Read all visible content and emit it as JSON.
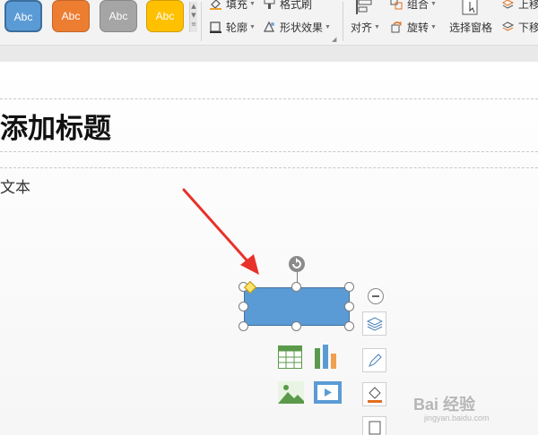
{
  "ribbon": {
    "style_gallery": [
      {
        "label": "Abc",
        "color": "#5b9bd5"
      },
      {
        "label": "Abc",
        "color": "#ed7d31"
      },
      {
        "label": "Abc",
        "color": "#a5a5a5"
      },
      {
        "label": "Abc",
        "color": "#ffc000"
      }
    ],
    "fill_label": "填充",
    "format_painter_label": "格式刷",
    "outline_label": "轮廓",
    "shape_effects_label": "形状效果",
    "align_label": "对齐",
    "group_label": "组合",
    "rotate_label": "旋转",
    "selection_pane_label": "选择窗格",
    "bring_forward_label": "上移",
    "send_backward_label": "下移"
  },
  "slide": {
    "title": "添加标题",
    "body": "文本"
  },
  "watermark": {
    "brand": "Bai 经验",
    "url": "jingyan.baidu.com"
  },
  "colors": {
    "shape_fill": "#5b9bd5",
    "arrow": "#e8312a"
  }
}
